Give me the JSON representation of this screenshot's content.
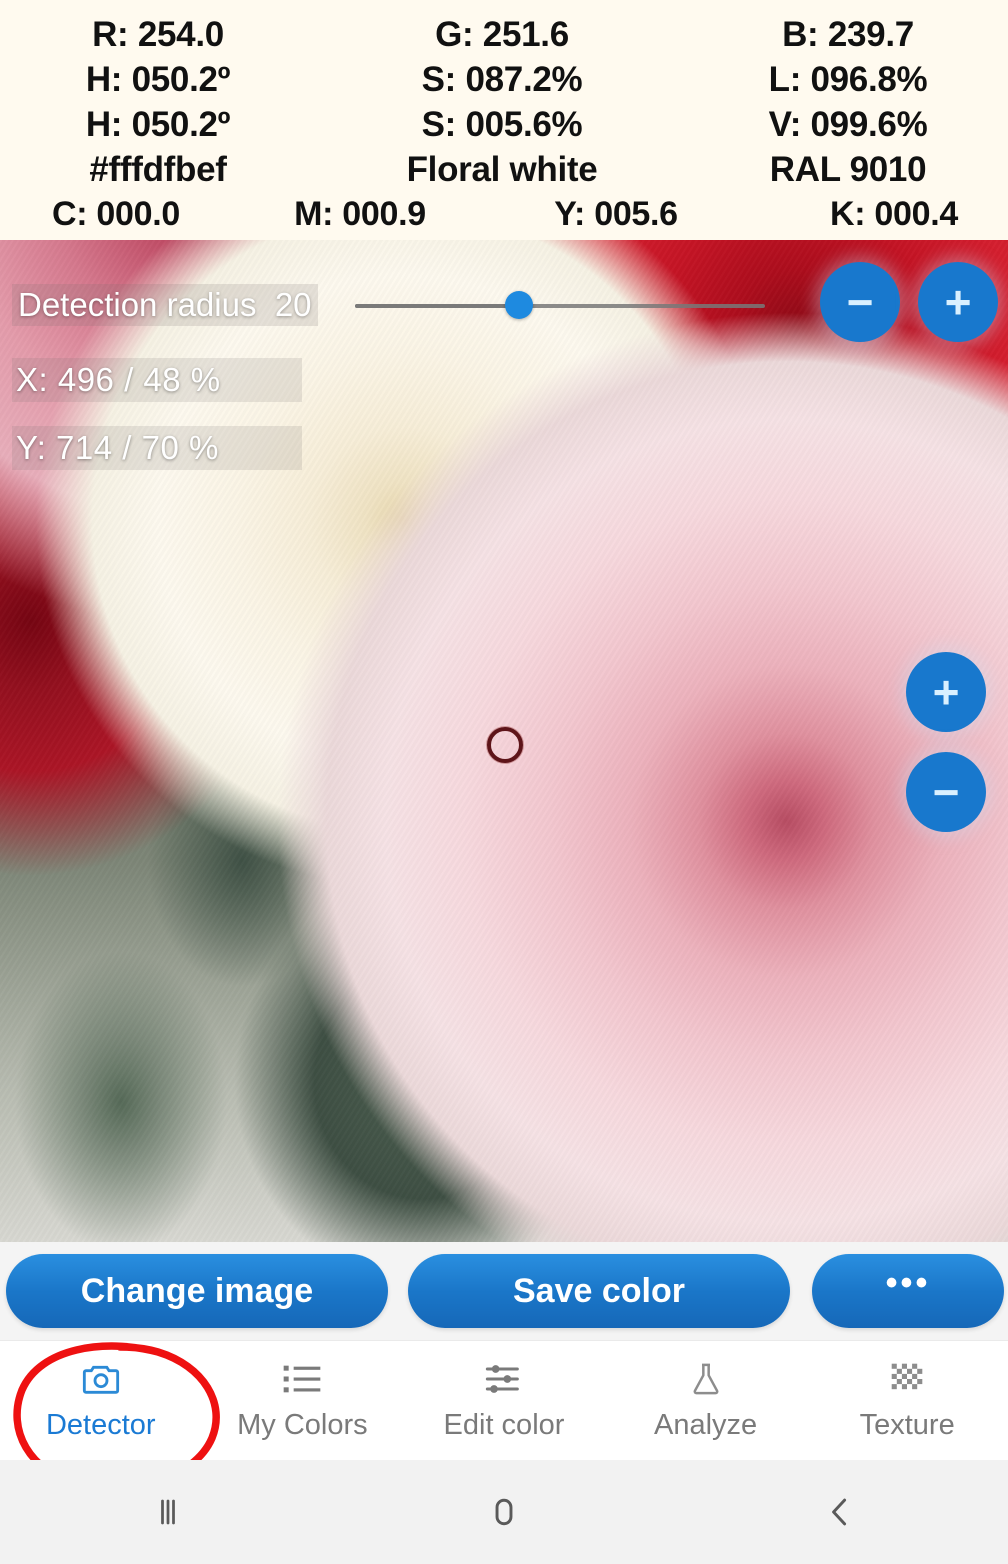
{
  "color_info": {
    "rows": [
      {
        "cells": [
          "R: 254.0",
          "G: 251.6",
          "B: 239.7"
        ]
      },
      {
        "cells": [
          "H: 050.2º",
          "S: 087.2%",
          "L: 096.8%"
        ]
      },
      {
        "cells": [
          "H: 050.2º",
          "S: 005.6%",
          "V: 099.6%"
        ]
      },
      {
        "cells": [
          "#fffdfbef",
          "Floral white",
          "RAL 9010"
        ]
      }
    ],
    "cmyk": [
      "C: 000.0",
      "M: 000.9",
      "Y: 005.6",
      "K: 000.4"
    ],
    "panel_background": "#fffaef",
    "detected_hex": "#fffdfbef",
    "detected_name": "Floral white",
    "detected_ral": "RAL 9010",
    "rgb": {
      "r": "254.0",
      "g": "251.6",
      "b": "239.7"
    },
    "hsl": {
      "h": "050.2º",
      "s": "087.2%",
      "l": "096.8%"
    },
    "hsv": {
      "h": "050.2º",
      "s": "005.6%",
      "v": "099.6%"
    }
  },
  "overlay": {
    "radius_label": "Detection radius",
    "radius_value": "20",
    "slider": {
      "percent": 40,
      "min": 0,
      "max": 50
    },
    "radius_minus": "−",
    "radius_plus": "+",
    "coord_x": "X: 496  /  48 %",
    "coord_y": "Y: 714  /  70 %",
    "x_pixel": "496",
    "x_percent": "48 %",
    "y_pixel": "714",
    "y_percent": "70 %",
    "zoom_in": "+",
    "zoom_out": "−"
  },
  "actions": {
    "change_image": "Change image",
    "save_color": "Save color",
    "more": "•••",
    "accent": "#1a76c8"
  },
  "tabs": [
    {
      "label": "Detector",
      "icon": "camera-icon",
      "active": true
    },
    {
      "label": "My Colors",
      "icon": "list-icon",
      "active": false
    },
    {
      "label": "Edit color",
      "icon": "sliders-icon",
      "active": false
    },
    {
      "label": "Analyze",
      "icon": "flask-icon",
      "active": false
    },
    {
      "label": "Texture",
      "icon": "checkerboard-icon",
      "active": false
    }
  ],
  "annotation": {
    "shape": "ellipse",
    "color": "#ee1111",
    "target": "Detector"
  },
  "system_nav": {
    "recents": "recents-icon",
    "home": "home-icon",
    "back": "back-icon"
  }
}
